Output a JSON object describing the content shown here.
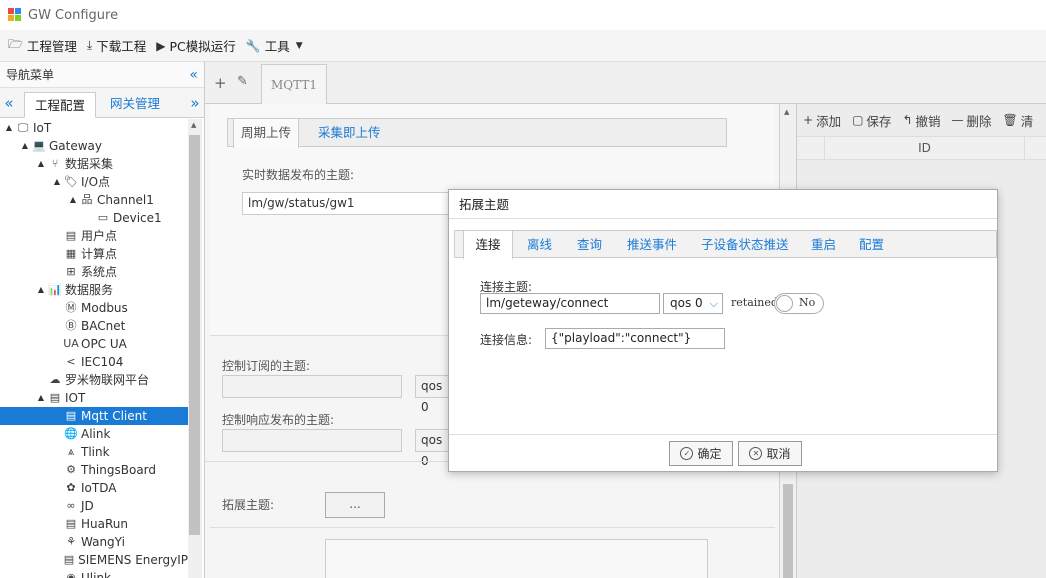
{
  "app": {
    "title": "GW Configure"
  },
  "menubar": [
    {
      "icon": "folder-icon",
      "label": "工程管理"
    },
    {
      "icon": "download-icon",
      "label": "下载工程"
    },
    {
      "icon": "play-icon",
      "label": "PC模拟运行"
    },
    {
      "icon": "wrench-icon",
      "label": "工具"
    }
  ],
  "sidebar": {
    "title": "导航菜单",
    "tabs": [
      "工程配置",
      "网关管理"
    ],
    "tree": [
      {
        "label": "IoT",
        "level": 0,
        "toggle": "▲",
        "icon": "monitor-icon"
      },
      {
        "label": "Gateway",
        "level": 1,
        "toggle": "▲",
        "icon": "laptop-icon"
      },
      {
        "label": "数据采集",
        "level": 2,
        "toggle": "▲",
        "icon": "fork-icon"
      },
      {
        "label": "I/O点",
        "level": 3,
        "toggle": "▲",
        "icon": "tag-icon"
      },
      {
        "label": "Channel1",
        "level": 4,
        "toggle": "▲",
        "icon": "network-icon"
      },
      {
        "label": "Device1",
        "level": 5,
        "toggle": "",
        "icon": "device-icon"
      },
      {
        "label": "用户点",
        "level": 3,
        "toggle": "",
        "icon": "table-icon"
      },
      {
        "label": "计算点",
        "level": 3,
        "toggle": "",
        "icon": "calc-icon"
      },
      {
        "label": "系统点",
        "level": 3,
        "toggle": "",
        "icon": "grid-icon"
      },
      {
        "label": "数据服务",
        "level": 2,
        "toggle": "▲",
        "icon": "chart-icon"
      },
      {
        "label": "Modbus",
        "level": 3,
        "toggle": "",
        "icon": "m-circle-icon"
      },
      {
        "label": "BACnet",
        "level": 3,
        "toggle": "",
        "icon": "b-circle-icon"
      },
      {
        "label": "OPC UA",
        "level": 3,
        "toggle": "",
        "icon": "ua-icon"
      },
      {
        "label": "IEC104",
        "level": 3,
        "toggle": "",
        "icon": "share-icon"
      },
      {
        "label": "罗米物联网平台",
        "level": 2,
        "toggle": "",
        "icon": "cloud-icon"
      },
      {
        "label": "IOT",
        "level": 2,
        "toggle": "▲",
        "icon": "iot-icon"
      },
      {
        "label": "Mqtt Client",
        "level": 3,
        "toggle": "",
        "icon": "iot-icon",
        "selected": true
      },
      {
        "label": "Alink",
        "level": 3,
        "toggle": "",
        "icon": "globe-icon"
      },
      {
        "label": "Tlink",
        "level": 3,
        "toggle": "",
        "icon": "tlink-icon"
      },
      {
        "label": "ThingsBoard",
        "level": 3,
        "toggle": "",
        "icon": "gear-icon"
      },
      {
        "label": "IoTDA",
        "level": 3,
        "toggle": "",
        "icon": "huawei-icon"
      },
      {
        "label": "JD",
        "level": 3,
        "toggle": "",
        "icon": "jd-icon"
      },
      {
        "label": "HuaRun",
        "level": 3,
        "toggle": "",
        "icon": "iot-icon"
      },
      {
        "label": "WangYi",
        "level": 3,
        "toggle": "",
        "icon": "wangyi-icon"
      },
      {
        "label": "SIEMENS EnergyIP",
        "level": 3,
        "toggle": "",
        "icon": "iot-icon"
      },
      {
        "label": "Ulink",
        "level": 3,
        "toggle": "",
        "icon": "ulink-icon"
      }
    ]
  },
  "main": {
    "doc_tab": "MQTT1",
    "inner_tabs": [
      "周期上传",
      "采集即上传"
    ],
    "publish_topic_label": "实时数据发布的主题:",
    "publish_topic_value": "lm/gw/status/gw1",
    "subscribe_label": "控制订阅的主题:",
    "subscribe_qos": "qos 0",
    "response_label": "控制响应发布的主题:",
    "response_qos": "qos 0",
    "ext_topic_label": "拓展主题:",
    "ext_button": "..."
  },
  "right_panel": {
    "toolbar": [
      {
        "icon": "plus-icon",
        "label": "添加"
      },
      {
        "icon": "save-icon",
        "label": "保存"
      },
      {
        "icon": "undo-icon",
        "label": "撤销"
      },
      {
        "icon": "minus-icon",
        "label": "删除"
      },
      {
        "icon": "trash-icon",
        "label": "清"
      }
    ],
    "column": "ID"
  },
  "modal": {
    "title": "拓展主题",
    "tabs": [
      "连接",
      "离线",
      "查询",
      "推送事件",
      "子设备状态推送",
      "重启",
      "配置"
    ],
    "connect_topic_label": "连接主题:",
    "connect_topic_value": "lm/geteway/connect",
    "qos_value": "qos 0",
    "retained_label": "retained:",
    "retained_value": "No",
    "connect_info_label": "连接信息:",
    "connect_info_value": "{\"playload\":\"connect\"}",
    "ok_label": "确定",
    "cancel_label": "取消"
  }
}
